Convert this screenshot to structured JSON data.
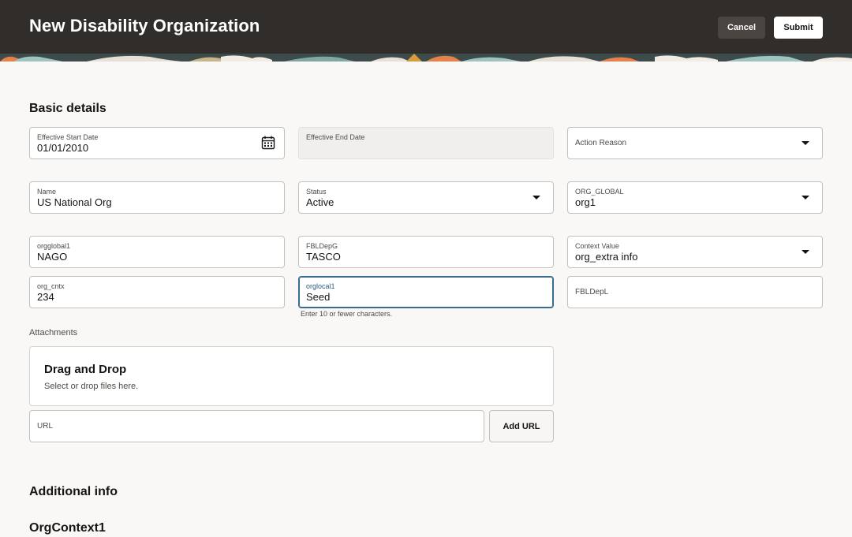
{
  "header": {
    "title": "New Disability Organization",
    "cancel_label": "Cancel",
    "submit_label": "Submit"
  },
  "basic_details": {
    "title": "Basic details",
    "effective_start_date": {
      "label": "Effective Start Date",
      "value": "01/01/2010"
    },
    "effective_end_date": {
      "label": "Effective End Date",
      "value": ""
    },
    "action_reason": {
      "label": "Action Reason",
      "value": ""
    },
    "name": {
      "label": "Name",
      "value": "US National Org"
    },
    "status": {
      "label": "Status",
      "value": "Active"
    },
    "org_global": {
      "label": "ORG_GLOBAL",
      "value": "org1"
    },
    "orgglobal1": {
      "label": "orgglobal1",
      "value": "NAGO"
    },
    "fbldepg": {
      "label": "FBLDepG",
      "value": "TASCO"
    },
    "context_value": {
      "label": "Context Value",
      "value": "org_extra info"
    },
    "org_cntx": {
      "label": "org_cntx",
      "value": "234"
    },
    "orglocal1": {
      "label": "orglocal1",
      "value": "Seed",
      "helper": "Enter 10 or fewer characters."
    },
    "fbldepl": {
      "label": "FBLDepL",
      "value": ""
    }
  },
  "attachments": {
    "label": "Attachments",
    "dropzone_title": "Drag and Drop",
    "dropzone_subtitle": "Select or drop files here.",
    "url_label": "URL",
    "add_url_label": "Add URL"
  },
  "additional_info": {
    "title": "Additional info"
  },
  "org_context": {
    "title": "OrgContext1"
  },
  "icons": {
    "calendar": "calendar-icon",
    "dropdown": "chevron-down-icon"
  },
  "colors": {
    "header_bg": "#312d2a",
    "focus": "#3a6c8d",
    "page_bg": "#f9f8f6"
  }
}
